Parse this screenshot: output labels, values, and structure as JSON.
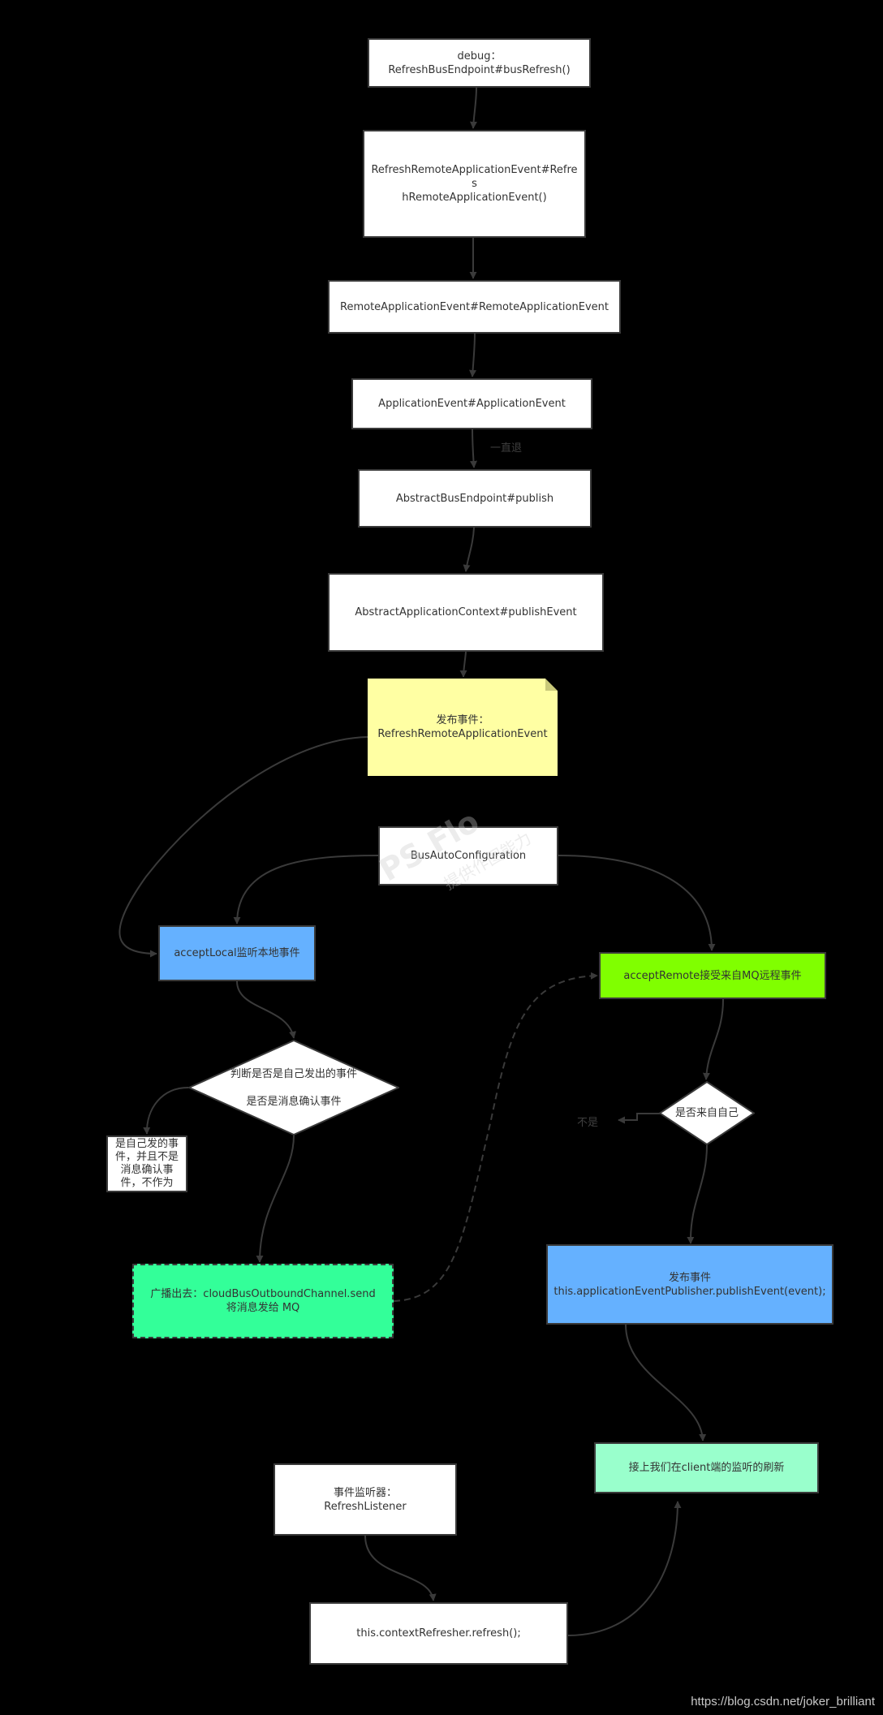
{
  "diagram": {
    "colors": {
      "background": "#000000",
      "edge": "#3a3a3a",
      "white_node": "#ffffff",
      "note": "#ffffa3",
      "local_listener": "#65b1ff",
      "remote_listener": "#80ff00",
      "broadcast": "#33ff99",
      "publish": "#65b1ff",
      "client_refresh": "#99ffcc"
    },
    "nodes": {
      "debug": "debug：\nRefreshBusEndpoint#busRefresh()",
      "refresh_remote_ctor": "RefreshRemoteApplicationEvent#Refres\nhRemoteApplicationEvent()",
      "remote_app_event": "RemoteApplicationEvent#RemoteApplicationEvent",
      "app_event": "ApplicationEvent#ApplicationEvent",
      "abstract_bus_endpoint": "AbstractBusEndpoint#publish",
      "abstract_app_context": "AbstractApplicationContext#publishEvent",
      "publish_note": "发布事件：\nRefreshRemoteApplicationEvent",
      "bus_auto_config": "BusAutoConfiguration",
      "accept_local": "acceptLocal监听本地事件",
      "accept_remote": "acceptRemote接受来自MQ远程事件",
      "decision_local": "判断是否是自己发出的事件\n\n是否是消息确认事件",
      "self_event_box": "是自己发的事件，并且不是消息确认事件，不作为",
      "decision_remote": "是否来自自己",
      "broadcast": "广播出去：cloudBusOutboundChannel.send\n将消息发给 MQ",
      "publish_event": "发布事件\nthis.applicationEventPublisher.publishEvent(event);",
      "client_refresh": "接上我们在client端的监听的刷新",
      "refresh_listener": "事件监听器：\nRefreshListener",
      "context_refresher": "this.contextRefresher.refresh();"
    },
    "edge_labels": {
      "keep_going_back": "一直退",
      "not_self": "不是"
    },
    "edges": [
      {
        "from": "debug",
        "to": "refresh_remote_ctor",
        "style": "solid"
      },
      {
        "from": "refresh_remote_ctor",
        "to": "remote_app_event",
        "style": "solid"
      },
      {
        "from": "remote_app_event",
        "to": "app_event",
        "style": "solid"
      },
      {
        "from": "app_event",
        "to": "abstract_bus_endpoint",
        "style": "solid",
        "label": "一直退"
      },
      {
        "from": "abstract_bus_endpoint",
        "to": "abstract_app_context",
        "style": "solid"
      },
      {
        "from": "abstract_app_context",
        "to": "publish_note",
        "style": "solid"
      },
      {
        "from": "publish_note",
        "to": "accept_local",
        "style": "solid"
      },
      {
        "from": "bus_auto_config",
        "to": "accept_local",
        "style": "solid"
      },
      {
        "from": "bus_auto_config",
        "to": "accept_remote",
        "style": "solid"
      },
      {
        "from": "accept_local",
        "to": "decision_local",
        "style": "solid"
      },
      {
        "from": "decision_local",
        "to": "self_event_box",
        "style": "solid"
      },
      {
        "from": "decision_local",
        "to": "broadcast",
        "style": "solid"
      },
      {
        "from": "broadcast",
        "to": "accept_remote",
        "style": "dashed"
      },
      {
        "from": "accept_remote",
        "to": "decision_remote",
        "style": "solid"
      },
      {
        "from": "decision_remote",
        "to": "not_self_label",
        "style": "solid",
        "label": "不是"
      },
      {
        "from": "decision_remote",
        "to": "publish_event",
        "style": "solid"
      },
      {
        "from": "publish_event",
        "to": "client_refresh",
        "style": "solid"
      },
      {
        "from": "refresh_listener",
        "to": "context_refresher",
        "style": "solid"
      },
      {
        "from": "context_refresher",
        "to": "client_refresh",
        "style": "solid"
      }
    ],
    "watermarks": {
      "tool_logo": "PS Flo",
      "tool_slogan": "提供作图能力",
      "source": "https://blog.csdn.net/joker_brilliant"
    }
  }
}
